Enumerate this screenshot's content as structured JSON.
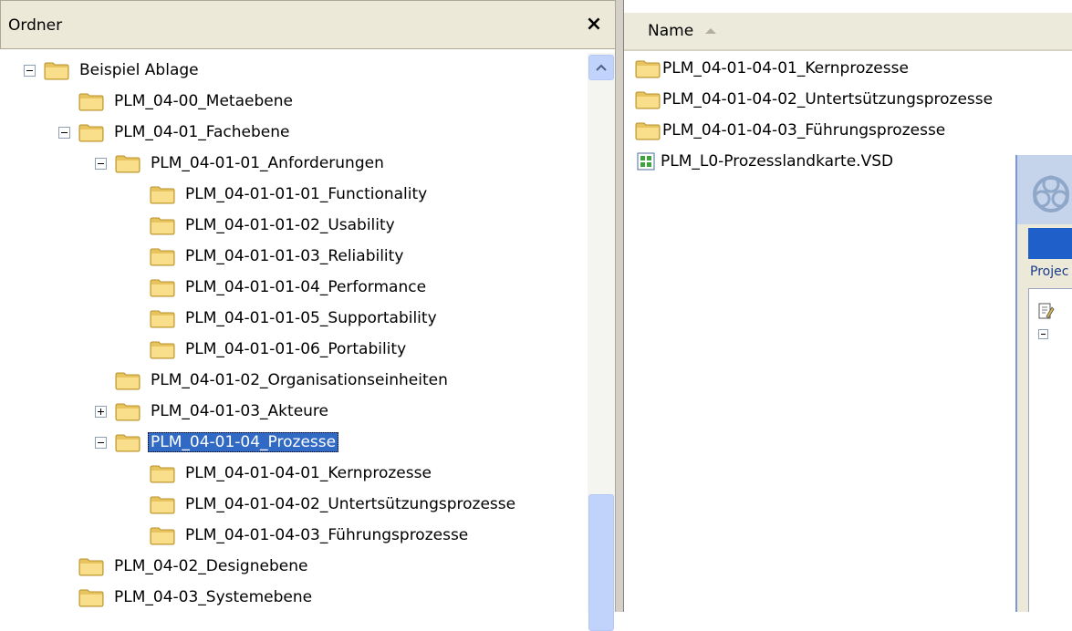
{
  "folder_pane": {
    "title": "Ordner",
    "close_label": "×",
    "tree": [
      {
        "label": "Beispiel Ablage",
        "depth": 0,
        "expander": "minus",
        "selected": false
      },
      {
        "label": "PLM_04-00_Metaebene",
        "depth": 1,
        "expander": "none",
        "selected": false
      },
      {
        "label": "PLM_04-01_Fachebene",
        "depth": 1,
        "expander": "minus",
        "selected": false
      },
      {
        "label": "PLM_04-01-01_Anforderungen",
        "depth": 2,
        "expander": "minus",
        "selected": false
      },
      {
        "label": "PLM_04-01-01-01_Functionality",
        "depth": 3,
        "expander": "none",
        "selected": false
      },
      {
        "label": "PLM_04-01-01-02_Usability",
        "depth": 3,
        "expander": "none",
        "selected": false
      },
      {
        "label": "PLM_04-01-01-03_Reliability",
        "depth": 3,
        "expander": "none",
        "selected": false
      },
      {
        "label": "PLM_04-01-01-04_Performance",
        "depth": 3,
        "expander": "none",
        "selected": false
      },
      {
        "label": "PLM_04-01-01-05_Supportability",
        "depth": 3,
        "expander": "none",
        "selected": false
      },
      {
        "label": "PLM_04-01-01-06_Portability",
        "depth": 3,
        "expander": "none",
        "selected": false
      },
      {
        "label": "PLM_04-01-02_Organisationseinheiten",
        "depth": 2,
        "expander": "none",
        "selected": false
      },
      {
        "label": "PLM_04-01-03_Akteure",
        "depth": 2,
        "expander": "plus",
        "selected": false
      },
      {
        "label": "PLM_04-01-04_Prozesse",
        "depth": 2,
        "expander": "minus",
        "selected": true
      },
      {
        "label": "PLM_04-01-04-01_Kernprozesse",
        "depth": 3,
        "expander": "none",
        "selected": false
      },
      {
        "label": "PLM_04-01-04-02_Untertsützungsprozesse",
        "depth": 3,
        "expander": "none",
        "selected": false
      },
      {
        "label": "PLM_04-01-04-03_Führungsprozesse",
        "depth": 3,
        "expander": "none",
        "selected": false
      },
      {
        "label": "PLM_04-02_Designebene",
        "depth": 1,
        "expander": "none",
        "selected": false
      },
      {
        "label": "PLM_04-03_Systemebene",
        "depth": 1,
        "expander": "none",
        "selected": false
      }
    ]
  },
  "list_pane": {
    "column_name": "Name",
    "sort": "ascending",
    "files": [
      {
        "label": "PLM_04-01-04-01_Kernprozesse",
        "icon": "folder-icon"
      },
      {
        "label": "PLM_04-01-04-02_Untertsützungsprozesse",
        "icon": "folder-icon"
      },
      {
        "label": "PLM_04-01-04-03_Führungsprozesse",
        "icon": "folder-icon"
      },
      {
        "label": "PLM_L0-Prozesslandkarte.VSD",
        "icon": "visio-file-icon"
      }
    ]
  },
  "app_window": {
    "tab_label": "Projec"
  },
  "colors": {
    "selection": "#316ac5",
    "folder": "#f7d57b",
    "pane_header": "#ece9d8",
    "scrollbar": "#c1d3fb"
  }
}
